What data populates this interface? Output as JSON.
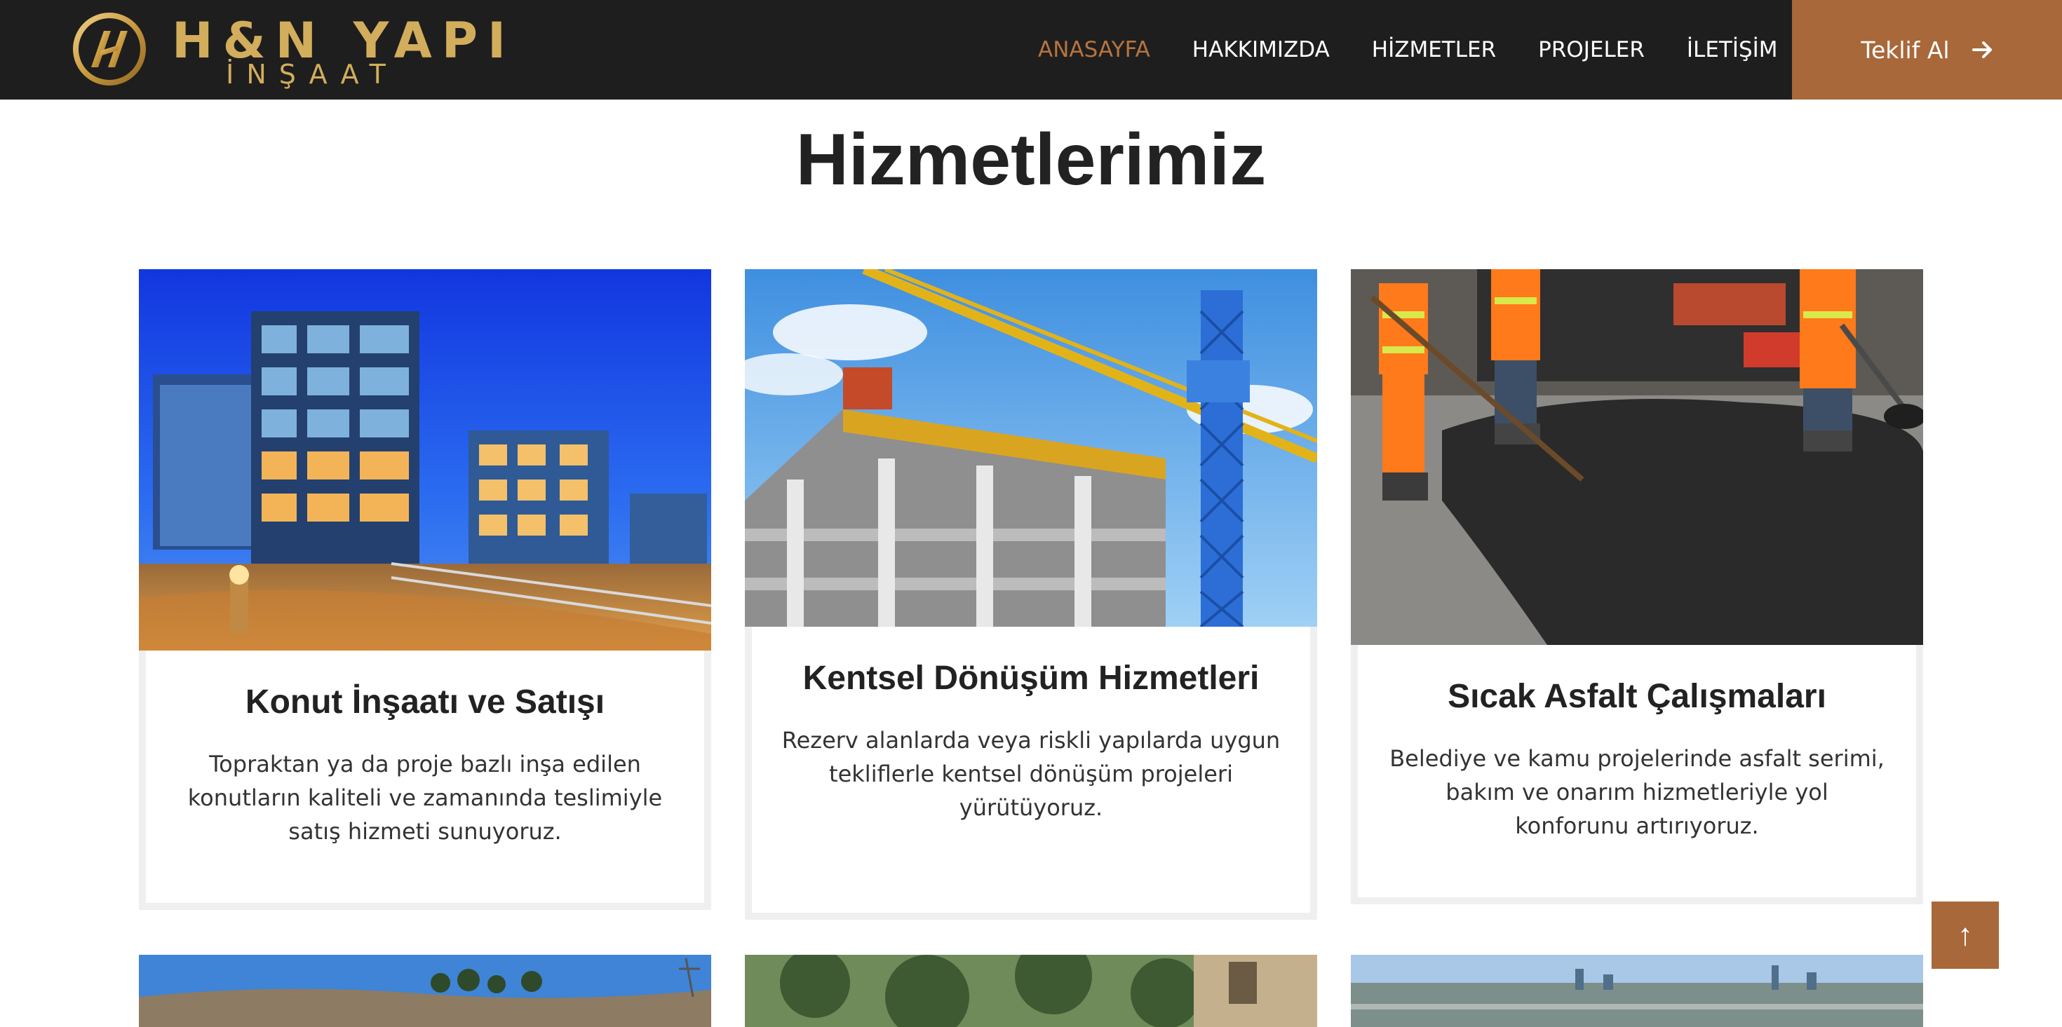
{
  "brand": {
    "name": "H&N YAPI",
    "subtitle": "İNŞAAT",
    "logo_icon": "hn-monogram-icon",
    "gold": "#d2ad5b"
  },
  "nav": {
    "items": [
      {
        "label": "ANASAYFA",
        "active": true
      },
      {
        "label": "HAKKIMIZDA",
        "active": false
      },
      {
        "label": "HİZMETLER",
        "active": false
      },
      {
        "label": "PROJELER",
        "active": false
      },
      {
        "label": "İLETİŞİM",
        "active": false
      }
    ],
    "active_color": "#b7733e"
  },
  "cta": {
    "label": "Teklif Al",
    "icon": "arrow-right-icon",
    "color": "#a8683a"
  },
  "services": {
    "title": "Hizmetlerimiz",
    "cards": [
      {
        "title": "Konut İnşaatı ve Satışı",
        "text": "Topraktan ya da proje bazlı inşa edilen konutların kaliteli ve zamanında teslimiyle satış hizmeti sunuyoruz.",
        "image": "residential-buildings-night-image"
      },
      {
        "title": "Kentsel Dönüşüm Hizmetleri",
        "text": "Rezerv alanlarda veya riskli yapılarda uygun tekliflerle kentsel dönüşüm projeleri yürütüyoruz.",
        "image": "construction-crane-image"
      },
      {
        "title": "Sıcak Asfalt Çalışmaları",
        "text": "Belediye ve kamu projelerinde asfalt serimi, bakım ve onarım hizmetleriyle yol konforunu artırıyoruz.",
        "image": "asphalt-paving-workers-image"
      }
    ]
  },
  "scroll_top": {
    "icon": "arrow-up-icon",
    "glyph": "↑"
  }
}
